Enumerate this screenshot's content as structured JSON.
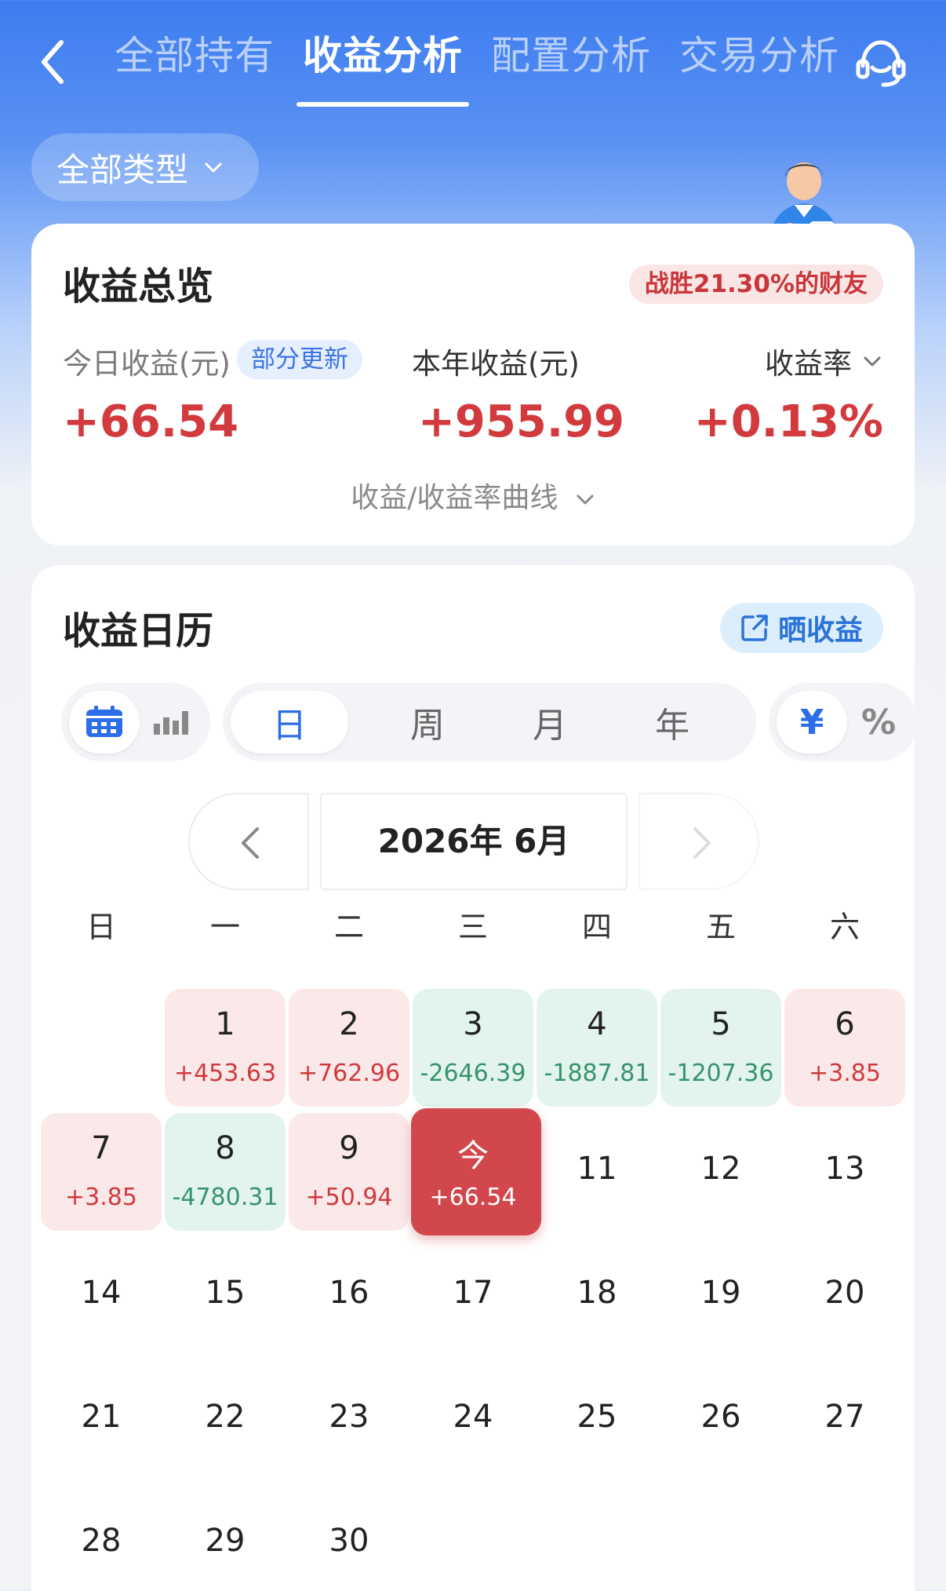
{
  "header": {
    "tabs": [
      {
        "label": "全部持有",
        "active": false
      },
      {
        "label": "收益分析",
        "active": true
      },
      {
        "label": "配置分析",
        "active": false
      },
      {
        "label": "交易分析",
        "active": false
      }
    ]
  },
  "filter": {
    "label": "全部类型"
  },
  "overview": {
    "title": "收益总览",
    "beat_badge": "战胜21.30%的财友",
    "today_label": "今日收益(元)",
    "partial_badge": "部分更新",
    "today_value": "+66.54",
    "year_label": "本年收益(元)",
    "year_value": "+955.99",
    "rate_label": "收益率",
    "rate_value": "+0.13%",
    "curve_link": "收益/收益率曲线"
  },
  "calendar": {
    "title": "收益日历",
    "share_label": "晒收益",
    "periods": [
      "日",
      "周",
      "月",
      "年"
    ],
    "units": [
      "¥",
      "%"
    ],
    "month_label": "2026年 6月",
    "weekdays": [
      "日",
      "一",
      "二",
      "三",
      "四",
      "五",
      "六"
    ],
    "start_offset": 1,
    "days": [
      {
        "d": "1",
        "v": "+453.63",
        "t": "pos"
      },
      {
        "d": "2",
        "v": "+762.96",
        "t": "pos"
      },
      {
        "d": "3",
        "v": "-2646.39",
        "t": "neg"
      },
      {
        "d": "4",
        "v": "-1887.81",
        "t": "neg"
      },
      {
        "d": "5",
        "v": "-1207.36",
        "t": "neg"
      },
      {
        "d": "6",
        "v": "+3.85",
        "t": "pos"
      },
      {
        "d": "7",
        "v": "+3.85",
        "t": "pos"
      },
      {
        "d": "8",
        "v": "-4780.31",
        "t": "neg"
      },
      {
        "d": "9",
        "v": "+50.94",
        "t": "pos"
      },
      {
        "d": "今",
        "v": "+66.54",
        "t": "today"
      },
      {
        "d": "11",
        "v": "",
        "t": "plain"
      },
      {
        "d": "12",
        "v": "",
        "t": "plain"
      },
      {
        "d": "13",
        "v": "",
        "t": "plain"
      },
      {
        "d": "14",
        "v": "",
        "t": "plain"
      },
      {
        "d": "15",
        "v": "",
        "t": "plain"
      },
      {
        "d": "16",
        "v": "",
        "t": "plain"
      },
      {
        "d": "17",
        "v": "",
        "t": "plain"
      },
      {
        "d": "18",
        "v": "",
        "t": "plain"
      },
      {
        "d": "19",
        "v": "",
        "t": "plain"
      },
      {
        "d": "20",
        "v": "",
        "t": "plain"
      },
      {
        "d": "21",
        "v": "",
        "t": "plain"
      },
      {
        "d": "22",
        "v": "",
        "t": "plain"
      },
      {
        "d": "23",
        "v": "",
        "t": "plain"
      },
      {
        "d": "24",
        "v": "",
        "t": "plain"
      },
      {
        "d": "25",
        "v": "",
        "t": "plain"
      },
      {
        "d": "26",
        "v": "",
        "t": "plain"
      },
      {
        "d": "27",
        "v": "",
        "t": "plain"
      },
      {
        "d": "28",
        "v": "",
        "t": "plain"
      },
      {
        "d": "29",
        "v": "",
        "t": "plain"
      },
      {
        "d": "30",
        "v": "",
        "t": "plain"
      }
    ]
  },
  "colors": {
    "primary": "#3d7cf0",
    "gain": "#d23a3e",
    "loss": "#36936d"
  },
  "icons": [
    "back-icon",
    "customer-service-icon",
    "chevron-down-icon",
    "share-icon",
    "calendar-icon",
    "bar-chart-icon",
    "chevron-left-icon",
    "chevron-right-icon"
  ]
}
